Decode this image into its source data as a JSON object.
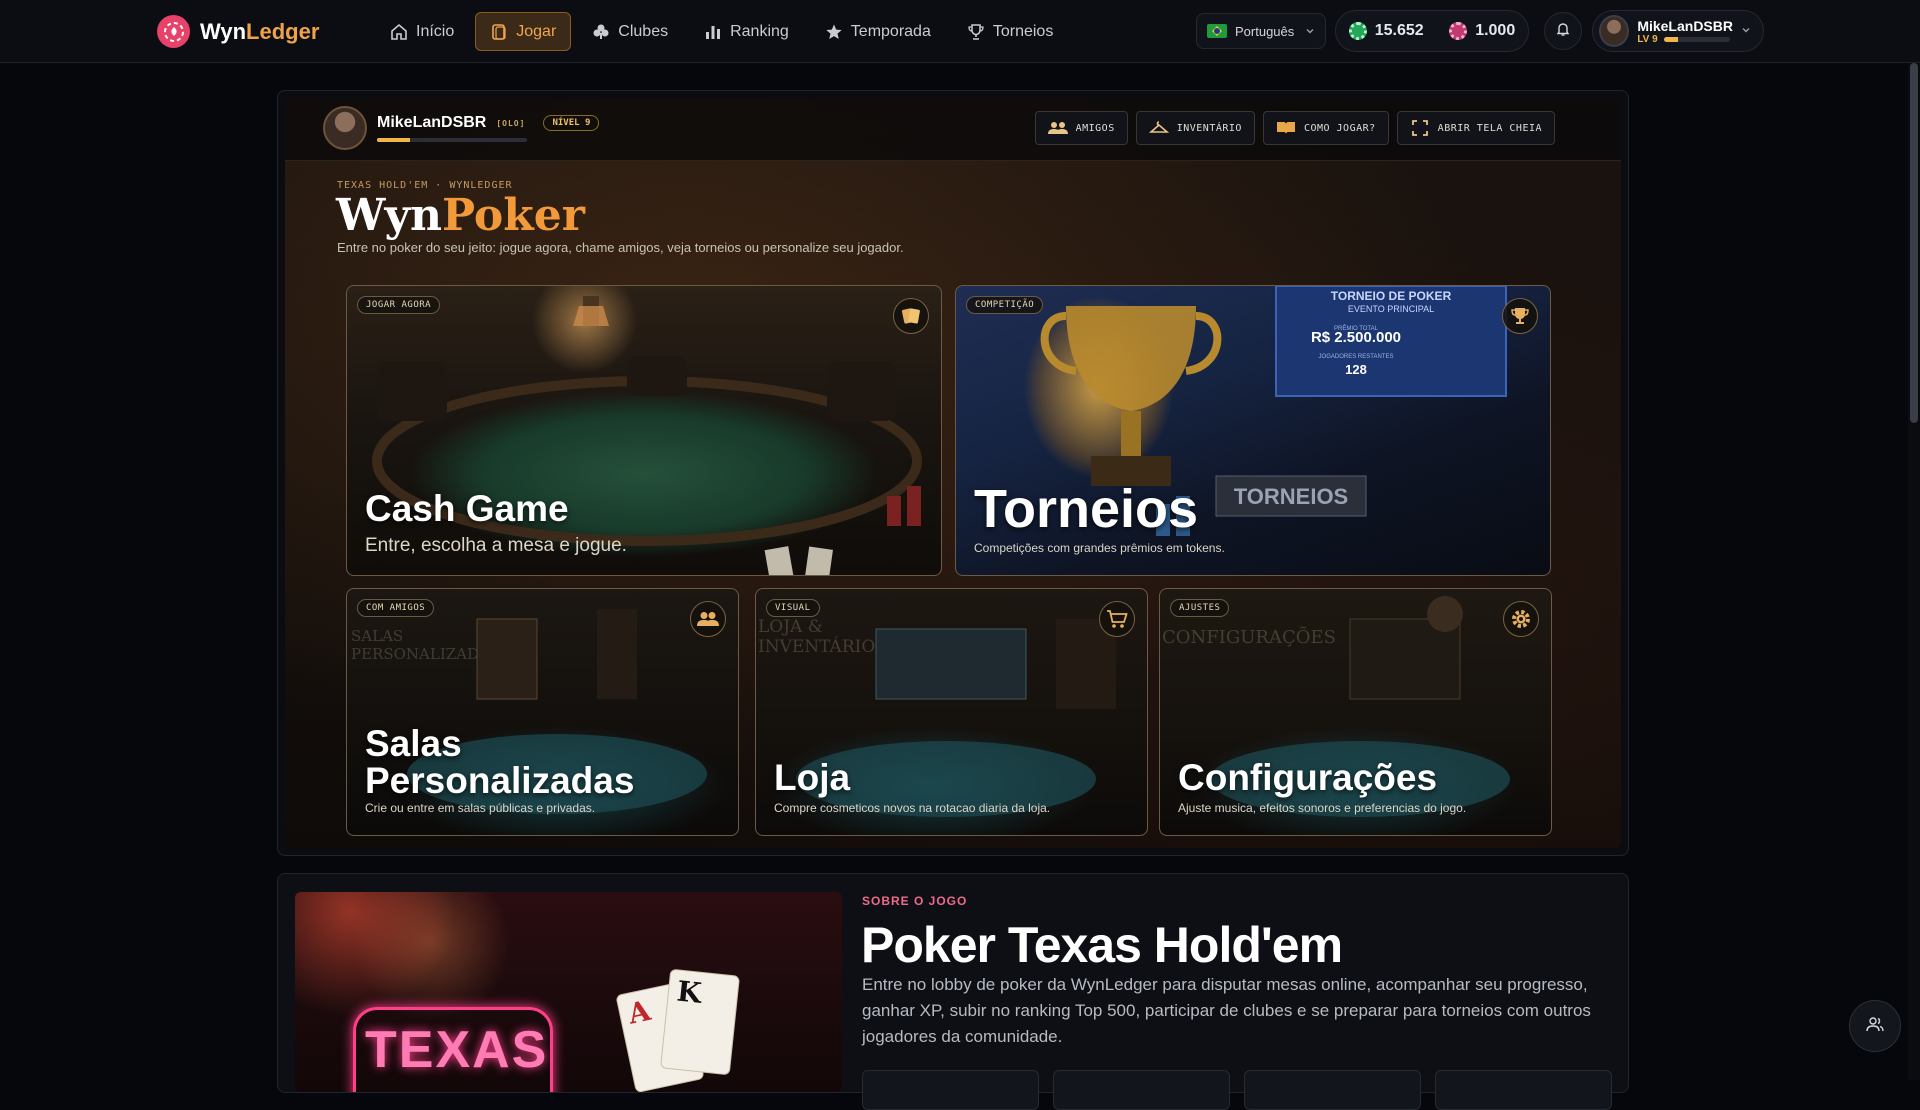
{
  "brand": {
    "name_a": "Wyn",
    "name_b": "Ledger"
  },
  "nav": [
    {
      "label": "Início",
      "icon": "home-icon",
      "active": false
    },
    {
      "label": "Jogar",
      "icon": "cards-icon",
      "active": true
    },
    {
      "label": "Clubes",
      "icon": "club-icon",
      "active": false
    },
    {
      "label": "Ranking",
      "icon": "bar-chart-icon",
      "active": false
    },
    {
      "label": "Temporada",
      "icon": "star-icon",
      "active": false
    },
    {
      "label": "Torneios",
      "icon": "trophy-icon",
      "active": false
    }
  ],
  "language": {
    "selected": "Português"
  },
  "wallet": {
    "chips": "15.652",
    "gems": "1.000"
  },
  "user": {
    "name": "MikeLanDSBR",
    "level": "LV 9",
    "xp_fraction": 0.22
  },
  "stage": {
    "player_name": "MikeLanDSBR",
    "player_tag": "[OLO]",
    "player_level": "NÍVEL 9",
    "player_xp_fraction": 0.22,
    "actions": [
      {
        "label": "AMIGOS",
        "icon": "friends-icon"
      },
      {
        "label": "INVENTÁRIO",
        "icon": "hanger-icon"
      },
      {
        "label": "COMO JOGAR?",
        "icon": "book-icon"
      },
      {
        "label": "ABRIR TELA CHEIA",
        "icon": "fullscreen-icon"
      }
    ],
    "kicker": "TEXAS HOLD'EM · WYNLEDGER",
    "title_a": "Wyn",
    "title_b": "Poker",
    "subtitle": "Entre no poker do seu jeito: jogue agora, chame amigos, veja torneios ou personalize seu jogador."
  },
  "cards": {
    "cash": {
      "badge": "JOGAR AGORA",
      "title": "Cash Game",
      "desc": "Entre, escolha a mesa e jogue.",
      "icon": "playing-cards-icon"
    },
    "torneios": {
      "badge": "COMPETIÇÃO",
      "title": "Torneios",
      "desc": "Competições com grandes prêmios em tokens.",
      "icon": "trophy-icon",
      "screen_line1": "TORNEIO DE POKER",
      "screen_line2": "EVENTO PRINCIPAL",
      "screen_prize_label": "PRÊMIO TOTAL",
      "screen_prize": "R$ 2.500.000",
      "screen_players_label": "JOGADORES RESTANTES",
      "screen_players": "128",
      "sign": "TORNEIOS"
    },
    "salas": {
      "badge": "COM AMIGOS",
      "title_line1": "Salas",
      "title_line2": "Personalizadas",
      "desc": "Crie ou entre em salas públicas e privadas.",
      "icon": "friends-icon",
      "bg": "SALAS PERSONALIZADAS"
    },
    "loja": {
      "badge": "VISUAL",
      "title": "Loja",
      "desc": "Compre cosmeticos novos na rotacao diaria da loja.",
      "icon": "cart-icon",
      "bg": "LOJA & INVENTÁRIO"
    },
    "config": {
      "badge": "AJUSTES",
      "title": "Configurações",
      "desc": "Ajuste musica, efeitos sonoros e preferencias do jogo.",
      "icon": "gear-icon",
      "bg": "CONFIGURAÇÕES"
    }
  },
  "about": {
    "kicker": "SOBRE O JOGO",
    "title": "Poker Texas Hold'em",
    "text": "Entre no lobby de poker da WynLedger para disputar mesas online, acompanhar seu progresso, ganhar XP, subir no ranking Top 500, participar de clubes e se preparar para torneios com outros jogadores da comunidade.",
    "neon": "TEXAS",
    "card1": "A",
    "card2": "K"
  }
}
